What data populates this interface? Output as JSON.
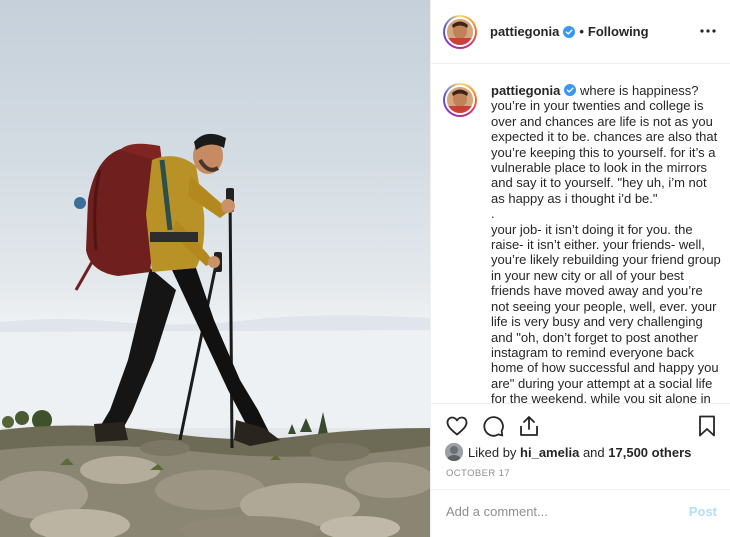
{
  "post": {
    "image_alt": "hiker with backpack and trekking poles on rocky ridge"
  },
  "header": {
    "username": "pattiegonia",
    "dot": "•",
    "follow_status": "Following"
  },
  "caption": {
    "username": "pattiegonia",
    "text": " where is happiness? you’re in your twenties and college is over and chances are life is not as you expected it to be. chances are also that you’re keeping this to yourself. for it’s a vulnerable place to look in the mirrors and say it to yourself. \"hey uh, i’m not as happy as i thought i’d be.\"\n.\nyour job- it isn’t doing it for you. the raise- it isn’t either. your friends- well, you’re likely rebuilding your friend group in your new city or all of your best friends have moved away and you’re not seeing your people, well, ever. your life is very busy and very challenging and \"oh, don’t forget to post another instagram to remind everyone back home of how successful and happy you are\" during your attempt at a social life for the weekend, while you sit alone in"
  },
  "likes": {
    "prefix": "Liked by",
    "user": "hi_amelia",
    "joiner": "and",
    "others": "17,500 others"
  },
  "date": "OCTOBER 17",
  "comment": {
    "placeholder": "Add a comment...",
    "post_label": "Post"
  },
  "colors": {
    "verified_blue": "#3897f0",
    "post_disabled": "#b2dffc",
    "meta_gray": "#8e8e8e"
  },
  "icons": [
    "heart-icon",
    "comment-icon",
    "share-icon",
    "bookmark-icon",
    "more-options-icon",
    "verified-badge-icon"
  ]
}
